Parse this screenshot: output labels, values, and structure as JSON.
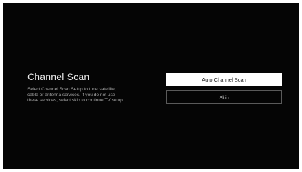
{
  "screen": {
    "title": "Channel Scan",
    "description_lines": [
      "Select Channel Scan Setup to tune satellite,",
      "cable or antenna services. If you do not use",
      "these services, select skip to continue TV setup."
    ]
  },
  "options": {
    "auto_scan_label": "Auto Channel Scan",
    "skip_label": "Skip"
  },
  "colors": {
    "background": "#050505",
    "selected_button_bg": "#ffffff",
    "unselected_button_border": "#5a5a5a"
  }
}
